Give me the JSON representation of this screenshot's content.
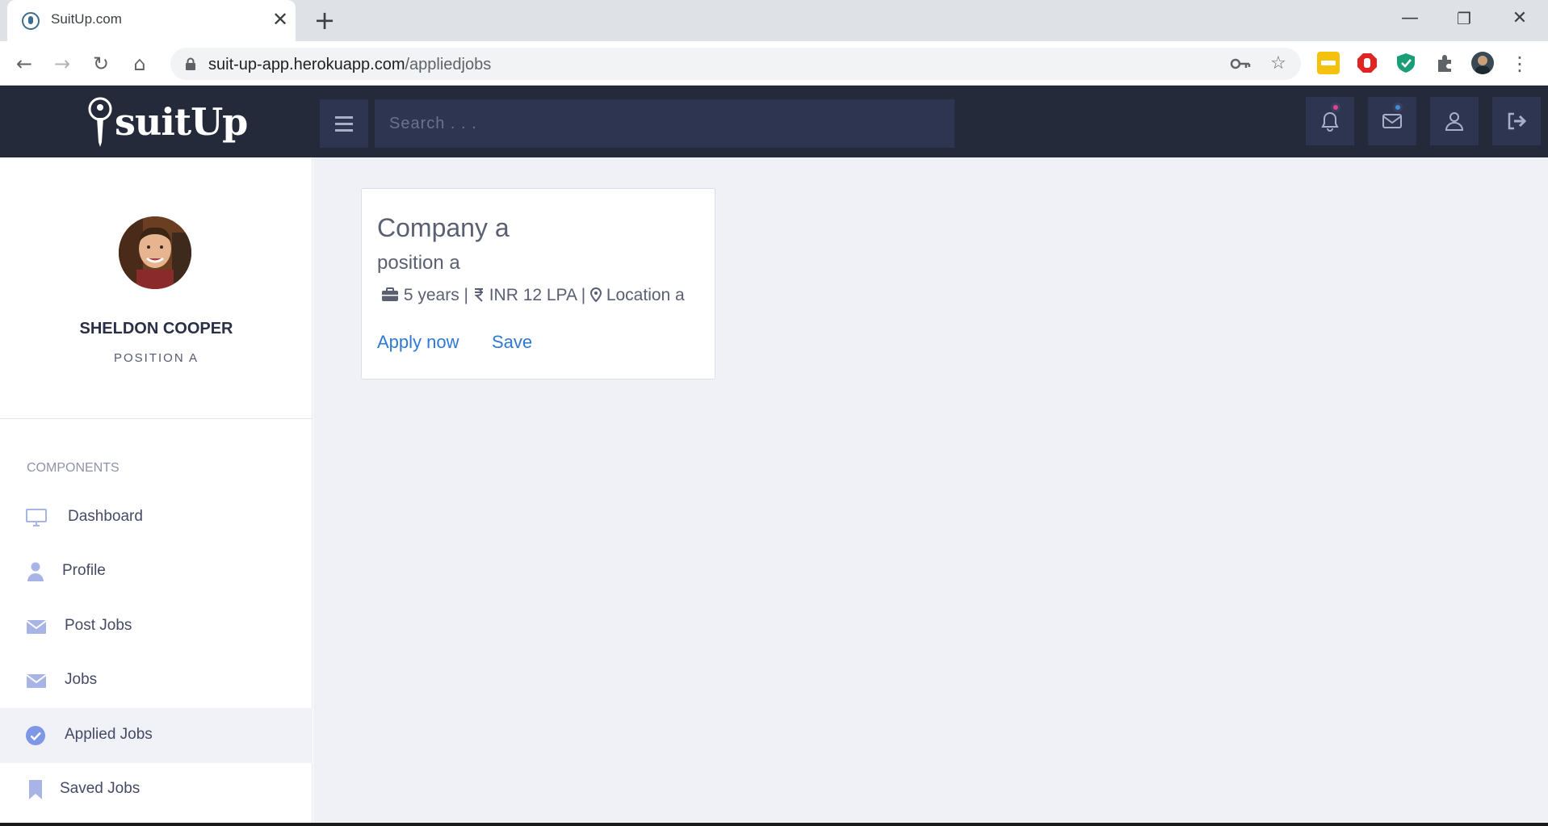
{
  "browser": {
    "tab_title": "SuitUp.com",
    "tab_close": "✕",
    "new_tab": "+",
    "url_domain": "suit-up-app.herokuapp.com",
    "url_path": "/appliedjobs",
    "window_controls": {
      "minimize": "—",
      "restore": "❐",
      "close": "✕"
    }
  },
  "header": {
    "logo_text": "suitUp",
    "search_placeholder": "Search . . ."
  },
  "user": {
    "name": "SHELDON COOPER",
    "position": "POSITION A"
  },
  "sidebar": {
    "section_label": "COMPONENTS",
    "items": [
      {
        "label": "Dashboard",
        "icon": "monitor-icon"
      },
      {
        "label": "Profile",
        "icon": "user-icon"
      },
      {
        "label": "Post Jobs",
        "icon": "envelope-icon"
      },
      {
        "label": "Jobs",
        "icon": "envelope-icon"
      },
      {
        "label": "Applied Jobs",
        "icon": "check-circle-icon",
        "active": true
      },
      {
        "label": "Saved Jobs",
        "icon": "bookmark-icon"
      }
    ]
  },
  "job": {
    "company": "Company a",
    "position": "position a",
    "experience": "5 years",
    "salary": "INR 12 LPA",
    "location": "Location a",
    "separator": " | ",
    "apply_label": "Apply now",
    "save_label": "Save"
  },
  "colors": {
    "header_bg": "#252a3a",
    "accent_link": "#2f78d6",
    "sidebar_icon": "#a9b4e6",
    "notification_dot": "#e0409a",
    "message_dot": "#3b8de0"
  }
}
